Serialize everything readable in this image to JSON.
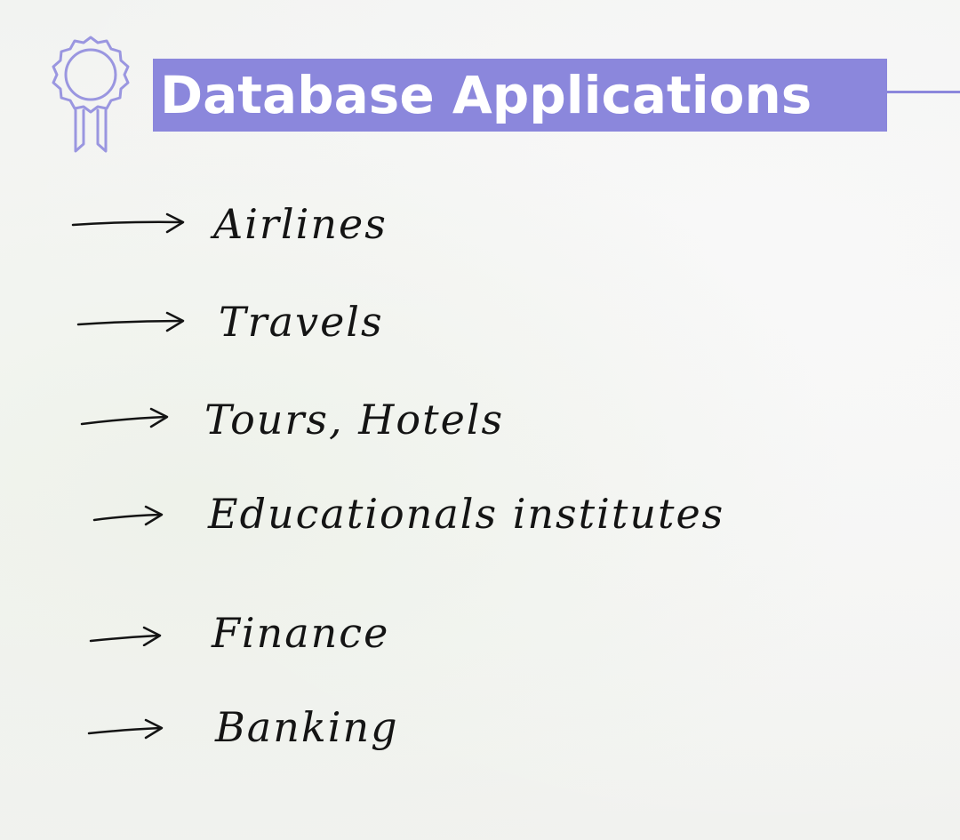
{
  "slide": {
    "title": "Database Applications",
    "icon": "award-ribbon-icon",
    "accent_color": "#8b87dc",
    "items": [
      {
        "label": "Airlines"
      },
      {
        "label": "Travels"
      },
      {
        "label": "Tours, Hotels"
      },
      {
        "label": "Educationals institutes"
      },
      {
        "label": "Finance"
      },
      {
        "label": "Banking"
      }
    ]
  }
}
